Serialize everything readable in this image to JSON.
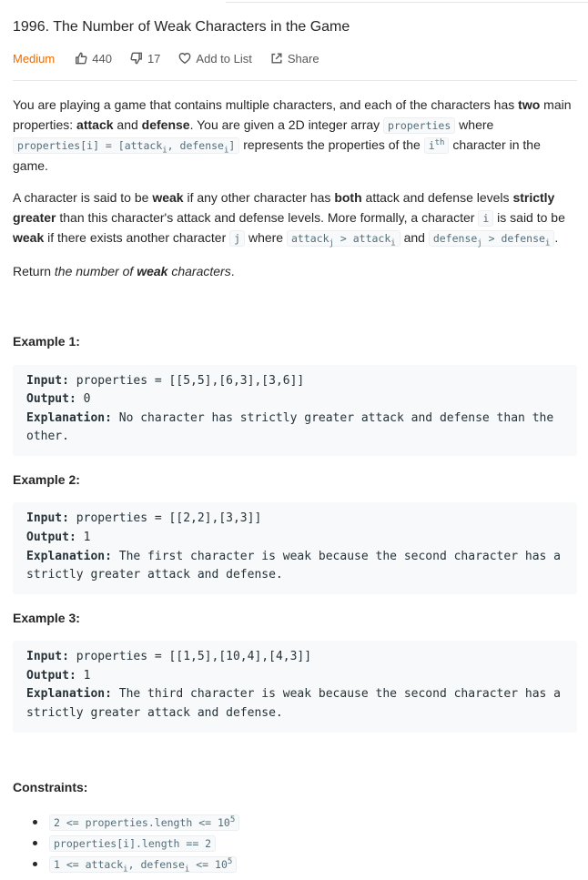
{
  "problem": {
    "title": "1996. The Number of Weak Characters in the Game",
    "difficulty": "Medium",
    "likes": "440",
    "dislikes": "17",
    "add_to_list": "Add to List",
    "share": "Share"
  },
  "description": {
    "p1": {
      "t1": "You are playing a game that contains multiple characters, and each of the characters has ",
      "b1": "two",
      "t2": " main properties: ",
      "b2": "attack",
      "t3": " and ",
      "b3": "defense",
      "t4": ". You are given a 2D integer array ",
      "c1": "properties",
      "t5": " where ",
      "c2a": "properties[i] = [attack",
      "c2sub1": "i",
      "c2b": ", defense",
      "c2sub2": "i",
      "c2c": "]",
      "t6": " represents the properties of the ",
      "c3": "i",
      "c3sup": "th",
      "t7": " character in the game."
    },
    "p2": {
      "t1": "A character is said to be ",
      "b1": "weak",
      "t2": " if any other character has ",
      "b2": "both",
      "t3": " attack and defense levels ",
      "b3": "strictly greater",
      "t4": " than this character's attack and defense levels. More formally, a character ",
      "c1": "i",
      "t5": " is said to be ",
      "b4": "weak",
      "t6": " if there exists another character ",
      "c2": "j",
      "t7": " where ",
      "c3a": "attack",
      "c3sub1": "j",
      "c3b": " > attack",
      "c3sub2": "i",
      "t8": " and ",
      "c4a": "defense",
      "c4sub1": "j",
      "c4b": " > defense",
      "c4sub2": "i",
      "t9": "."
    },
    "p3": {
      "t1": "Return ",
      "i1": "the number of ",
      "ib": "weak",
      "i2": " characters",
      "t2": "."
    }
  },
  "examples": [
    {
      "title": "Example 1:",
      "input_label": "Input:",
      "input": " properties = [[5,5],[6,3],[3,6]]",
      "output_label": "Output:",
      "output": " 0",
      "explanation_label": "Explanation:",
      "explanation": " No character has strictly greater attack and defense than the other."
    },
    {
      "title": "Example 2:",
      "input_label": "Input:",
      "input": " properties = [[2,2],[3,3]]",
      "output_label": "Output:",
      "output": " 1",
      "explanation_label": "Explanation:",
      "explanation": " The first character is weak because the second character has a strictly greater attack and defense."
    },
    {
      "title": "Example 3:",
      "input_label": "Input:",
      "input": " properties = [[1,5],[10,4],[4,3]]",
      "output_label": "Output:",
      "output": " 1",
      "explanation_label": "Explanation:",
      "explanation": " The third character is weak because the second character has a strictly greater attack and defense."
    }
  ],
  "constraints": {
    "title": "Constraints:",
    "c1a": "2 <= properties.length <= 10",
    "c1sup": "5",
    "c2": "properties[i].length == 2",
    "c3a": "1 <= attack",
    "c3sub1": "i",
    "c3b": ", defense",
    "c3sub2": "i",
    "c3c": " <= 10",
    "c3sup": "5"
  },
  "colors": {
    "difficulty_medium": "#ef6c00",
    "code_bg": "#f7f9fa",
    "code_text": "#546e7a"
  },
  "icons": [
    "thumbs-up-icon",
    "thumbs-down-icon",
    "heart-icon",
    "share-icon"
  ]
}
